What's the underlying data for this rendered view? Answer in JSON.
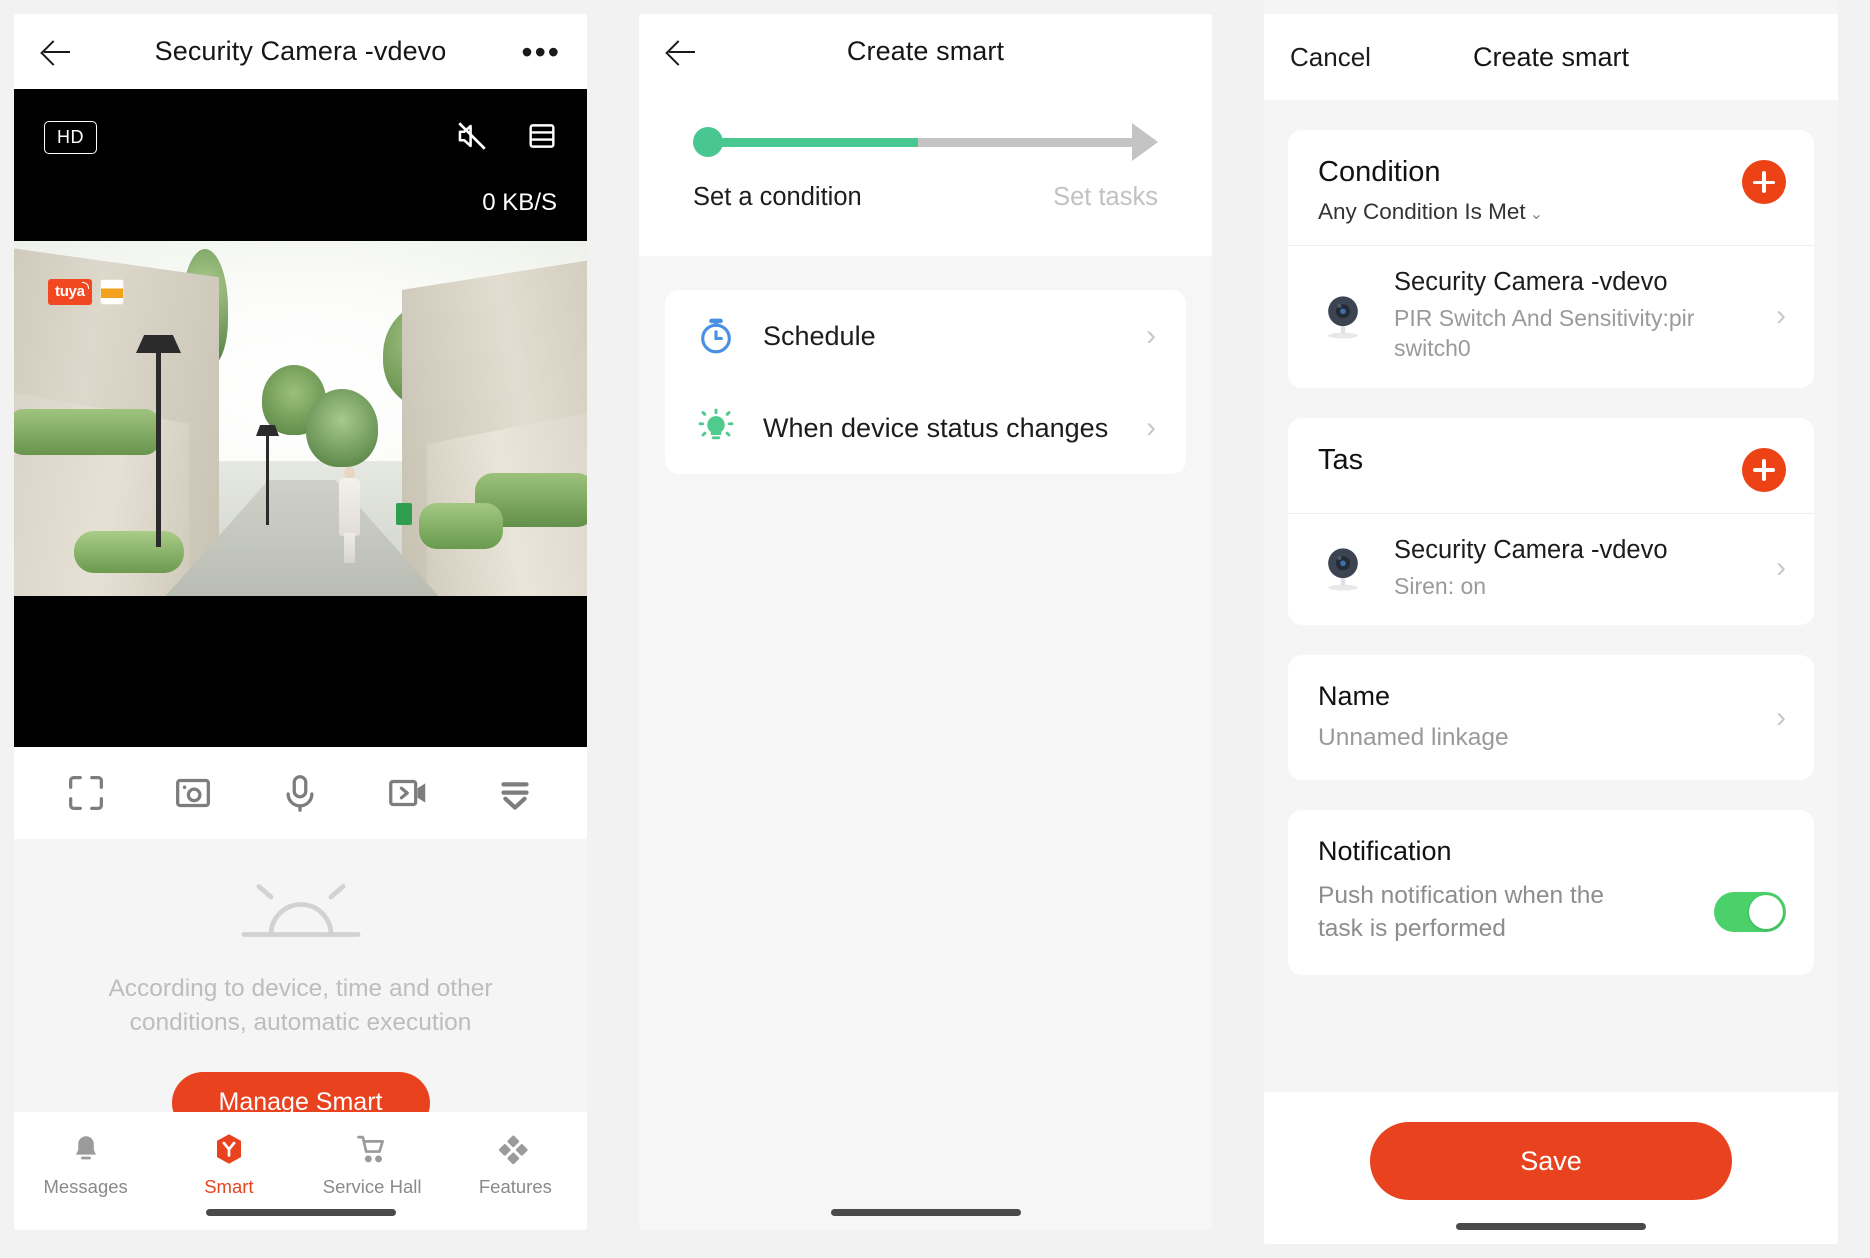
{
  "camera_screen": {
    "nav": {
      "back_icon": "back-arrow-icon",
      "title": "Security Camera -vdevo",
      "more_icon": "more-options-icon",
      "more_label": "•••"
    },
    "video": {
      "quality_badge": "HD",
      "bitrate": "0 KB/S",
      "mute_icon": "mute-speaker-icon",
      "layout_icon": "split-view-icon",
      "watermark": "tuya"
    },
    "controls": [
      {
        "name": "fullscreen-icon",
        "label": "Fullscreen"
      },
      {
        "name": "snapshot-icon",
        "label": "Screenshot"
      },
      {
        "name": "microphone-icon",
        "label": "Speak"
      },
      {
        "name": "record-icon",
        "label": "Record"
      },
      {
        "name": "more-controls-icon",
        "label": "More"
      }
    ],
    "promo": {
      "icon": "sunrise-automation-icon",
      "text": "According to device, time and other conditions, automatic execution",
      "button": "Manage Smart"
    },
    "tabs": [
      {
        "label": "Messages",
        "icon": "bell-icon",
        "active": false
      },
      {
        "label": "Smart",
        "icon": "hexagon-y-icon",
        "active": true
      },
      {
        "label": "Service Hall",
        "icon": "cart-icon",
        "active": false
      },
      {
        "label": "Features",
        "icon": "diamonds-icon",
        "active": false
      }
    ]
  },
  "create_smart_step1": {
    "nav": {
      "back_icon": "back-arrow-icon",
      "title": "Create smart"
    },
    "stepper": {
      "current_step": 1,
      "total_steps": 2,
      "progress_percent": 48,
      "step1_label": "Set a condition",
      "step2_label": "Set tasks"
    },
    "options": [
      {
        "label": "Schedule",
        "icon": "stopwatch-icon",
        "color": "#4a90e2"
      },
      {
        "label": "When device status changes",
        "icon": "bulb-icon",
        "color": "#4ecb8d"
      }
    ]
  },
  "create_smart_step2": {
    "nav": {
      "cancel": "Cancel",
      "title": "Create smart"
    },
    "condition": {
      "title": "Condition",
      "mode": "Any Condition Is Met",
      "mode_caret": "⌄",
      "add_icon": "add-condition-icon",
      "items": [
        {
          "icon": "security-camera-icon",
          "name": "Security Camera -vdevo",
          "detail": "PIR Switch And Sensitivity:pir switch0"
        }
      ]
    },
    "task": {
      "title": "Tas",
      "add_icon": "add-task-icon",
      "items": [
        {
          "icon": "security-camera-icon",
          "name": "Security Camera -vdevo",
          "detail": "Siren: on"
        }
      ]
    },
    "name_section": {
      "title": "Name",
      "value": "Unnamed linkage"
    },
    "notification": {
      "title": "Notification",
      "description": "Push notification when the task is performed",
      "enabled": true
    },
    "save_button": "Save"
  },
  "theme": {
    "accent_red": "#e8421f",
    "accent_orange": "#ec4216",
    "accent_green": "#48c791",
    "toggle_green": "#4bd16a",
    "muted_gray": "#bdbdbd"
  }
}
